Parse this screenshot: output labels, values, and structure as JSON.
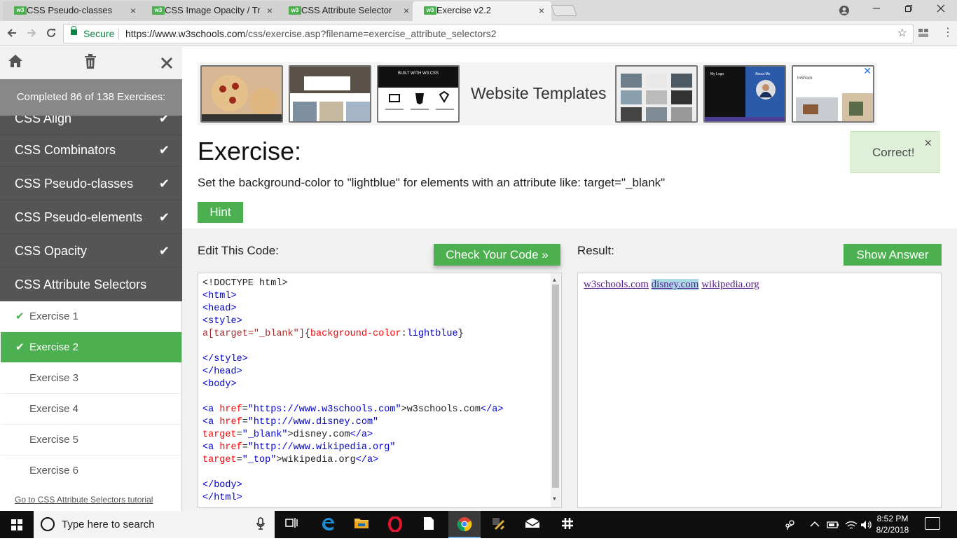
{
  "browser": {
    "tabs": [
      {
        "title": "CSS Pseudo-classes",
        "favicon": "w3"
      },
      {
        "title": "CSS Image Opacity / Tran",
        "favicon": "w3"
      },
      {
        "title": "CSS Attribute Selector",
        "favicon": "w3"
      },
      {
        "title": "Exercise v2.2",
        "favicon": "w3"
      }
    ],
    "secure_label": "Secure",
    "url_host": "https://www.w3schools.com",
    "url_path": "/css/exercise.asp?filename=exercise_attribute_selectors2",
    "close_glyph": "×"
  },
  "sidebar": {
    "completed_text": "Completed 86 of 138 Exercises:",
    "topics": [
      {
        "label": "CSS Align",
        "done": true
      },
      {
        "label": "CSS Combinators",
        "done": true
      },
      {
        "label": "CSS Pseudo-classes",
        "done": true
      },
      {
        "label": "CSS Pseudo-elements",
        "done": true
      },
      {
        "label": "CSS Opacity",
        "done": true
      },
      {
        "label": "CSS Attribute Selectors",
        "done": false
      }
    ],
    "exercises": [
      {
        "label": "Exercise 1",
        "done": true
      },
      {
        "label": "Exercise 2",
        "done": true,
        "active": true
      },
      {
        "label": "Exercise 3",
        "done": false
      },
      {
        "label": "Exercise 4",
        "done": false
      },
      {
        "label": "Exercise 5",
        "done": false
      },
      {
        "label": "Exercise 6",
        "done": false
      }
    ],
    "tutorial_link": "Go to CSS Attribute Selectors tutorial",
    "check_glyph": "✔"
  },
  "ad": {
    "text": "Website Templates",
    "thumb_text": "BUILT WITH W3.CSS",
    "thumb_text2": "My Logo",
    "thumb_text3": "About Me",
    "thumb_text4": "InShock"
  },
  "exercise": {
    "title": "Exercise:",
    "correct_text": "Correct!",
    "instruction": "Set the background-color to \"lightblue\" for elements with an attribute like: target=\"_blank\"",
    "hint_label": "Hint",
    "edit_label": "Edit This Code:",
    "check_label": "Check Your Code »",
    "result_label": "Result:",
    "answer_label": "Show Answer"
  },
  "code": {
    "l1": "<!DOCTYPE html>",
    "l2": "<html>",
    "l3": "<head>",
    "l4": "<style>",
    "l5_sel": "a",
    "l5_attr": "[target=\"_blank\"]",
    "l5_prop": "background-color",
    "l5_val": "lightblue",
    "l6": "</style>",
    "l7": "</head>",
    "l8": "<body>",
    "a1_href": "\"https://www.w3schools.com\"",
    "a1_text": "w3schools.com",
    "a2_href": "\"http://www.disney.com\"",
    "a2_target": "\"_blank\"",
    "a2_text": "disney.com",
    "a3_href": "\"http://www.wikipedia.org\"",
    "a3_target": "\"_top\"",
    "a3_text": "wikipedia.org",
    "l_end_body": "</body>",
    "l_end_html": "</html>"
  },
  "result": {
    "links": [
      "w3schools.com",
      "disney.com",
      "wikipedia.org"
    ]
  },
  "taskbar": {
    "search_placeholder": "Type here to search",
    "time": "8:52 PM",
    "date": "8/2/2018"
  }
}
